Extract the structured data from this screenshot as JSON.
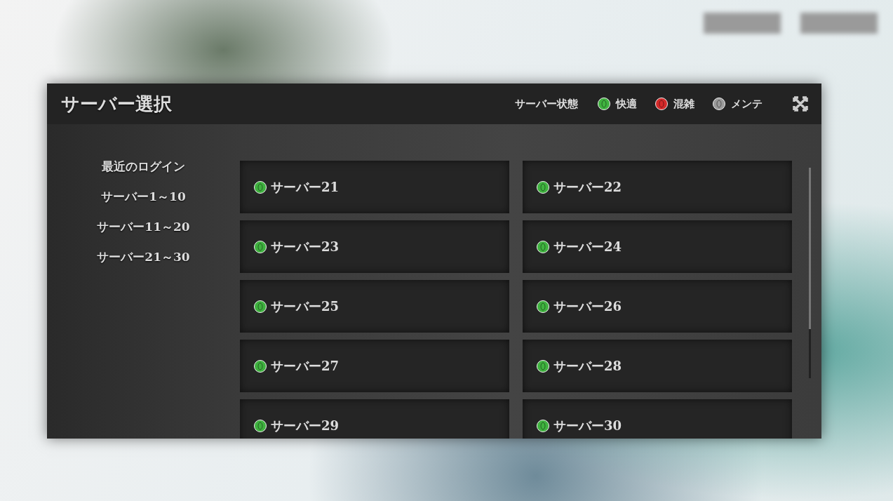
{
  "dialog": {
    "title": "サーバー選択",
    "legend_label": "サーバー状態",
    "legend": [
      {
        "label": "快適",
        "color": "#3fb23f"
      },
      {
        "label": "混雑",
        "color": "#d42a2a"
      },
      {
        "label": "メンテ",
        "color": "#9a9a9a"
      }
    ]
  },
  "sidebar": {
    "items": [
      {
        "label": "最近のログイン"
      },
      {
        "label": "サーバー1～10"
      },
      {
        "label": "サーバー11～20"
      },
      {
        "label": "サーバー21～30"
      }
    ]
  },
  "servers": [
    {
      "name": "サーバー21",
      "color": "#3fb23f"
    },
    {
      "name": "サーバー22",
      "color": "#3fb23f"
    },
    {
      "name": "サーバー23",
      "color": "#3fb23f"
    },
    {
      "name": "サーバー24",
      "color": "#3fb23f"
    },
    {
      "name": "サーバー25",
      "color": "#3fb23f"
    },
    {
      "name": "サーバー26",
      "color": "#3fb23f"
    },
    {
      "name": "サーバー27",
      "color": "#3fb23f"
    },
    {
      "name": "サーバー28",
      "color": "#3fb23f"
    },
    {
      "name": "サーバー29",
      "color": "#3fb23f"
    },
    {
      "name": "サーバー30",
      "color": "#3fb23f"
    }
  ]
}
